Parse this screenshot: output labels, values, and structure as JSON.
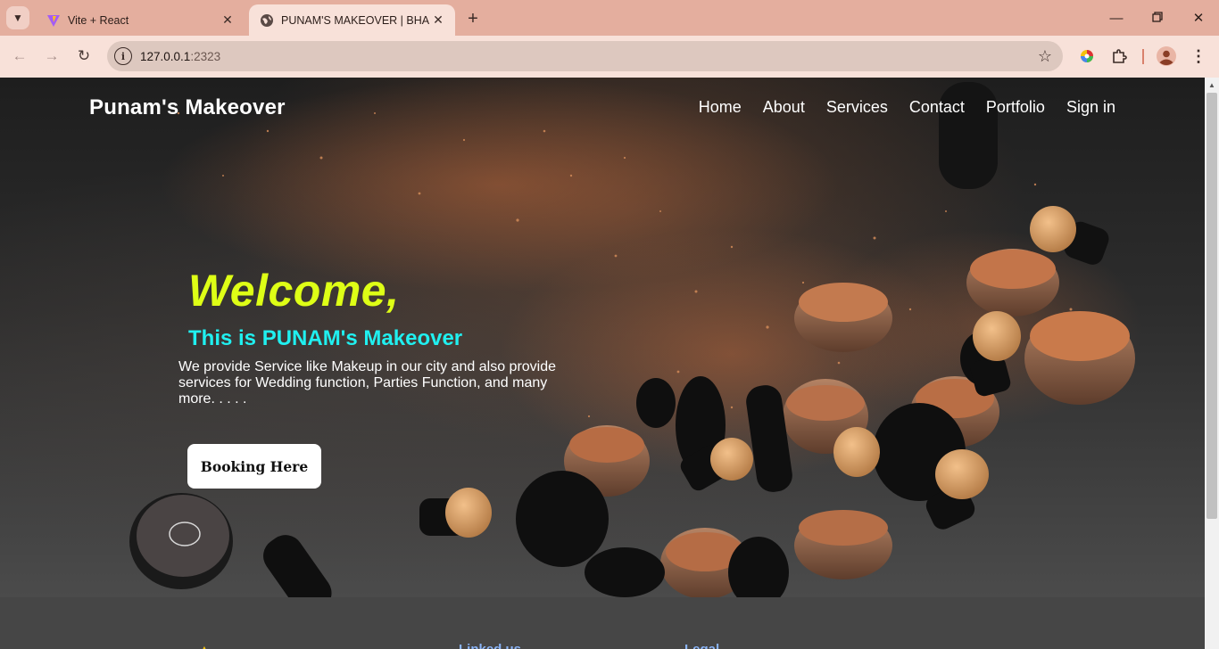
{
  "browser": {
    "tabs": [
      {
        "title": "Vite + React",
        "favicon": "vite-logo-icon",
        "active": false
      },
      {
        "title": "PUNAM'S MAKEOVER | BHANDARA",
        "favicon": "globe-icon",
        "active": true
      }
    ],
    "url_host": "127.0.0.1",
    "url_port": ":2323",
    "accent": "#e4ae9e"
  },
  "site": {
    "brand": "Punam's Makeover",
    "nav": [
      "Home",
      "About",
      "Services",
      "Contact",
      "Portfolio",
      "Sign in"
    ]
  },
  "hero": {
    "welcome": "Welcome,",
    "subtitle": "This is PUNAM's Makeover",
    "description": "We provide Service like Makeup in our city and also provide services for Wedding function, Parties Function, and many more. . . . .",
    "cta_label": "Booking Here",
    "welcome_color": "#deff16",
    "subtitle_color": "#20f0f0"
  },
  "footer": {
    "items": [
      "Linked us",
      "Legal"
    ]
  }
}
